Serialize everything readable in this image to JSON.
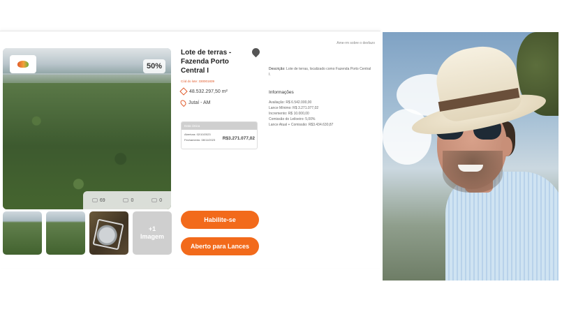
{
  "header": {
    "top_link": "Ame-rm sobre o desfazo"
  },
  "listing": {
    "discount_badge": "50%",
    "stats": {
      "views": "69",
      "favorites": "0",
      "bids": "0"
    },
    "thumbnails": {
      "more_label_line1": "+1",
      "more_label_line2": "Imagem"
    },
    "title": "Lote de terras - Fazenda Porto Central I",
    "lot_code": "Cód do lote: 330001839",
    "area": "48.532.297,50 m²",
    "location": "Jutaí - AM",
    "dates": {
      "header": "Data Única",
      "opening": "Abertura: 02/10/2023",
      "closing": "Fechamento: 08/11/2023",
      "price": "R$3.271.077,02"
    },
    "buttons": {
      "enable": "Habilite-se",
      "open_bids": "Aberto para Lances"
    }
  },
  "details": {
    "description_label": "Descrição:",
    "description": "Lote de terras, localizado como Fazenda Porto Central I.",
    "info_heading": "Informações",
    "lines": [
      "Avaliação: R$ 6.542.000,00",
      "Lance Mínimo: R$ 3.271.077,02",
      "Incremento: R$ 10.000,00",
      "Comissão do Leiloeiro: 5,00%",
      "Lance Atual + Comissão: R$3.434.630,87"
    ]
  },
  "colors": {
    "accent": "#f26a1b",
    "code_red": "#e05a2a"
  },
  "icons": [
    "leaf-logo-icon",
    "views-icon",
    "heart-icon",
    "bid-icon",
    "area-icon",
    "location-pin-icon",
    "share-pin-icon"
  ]
}
